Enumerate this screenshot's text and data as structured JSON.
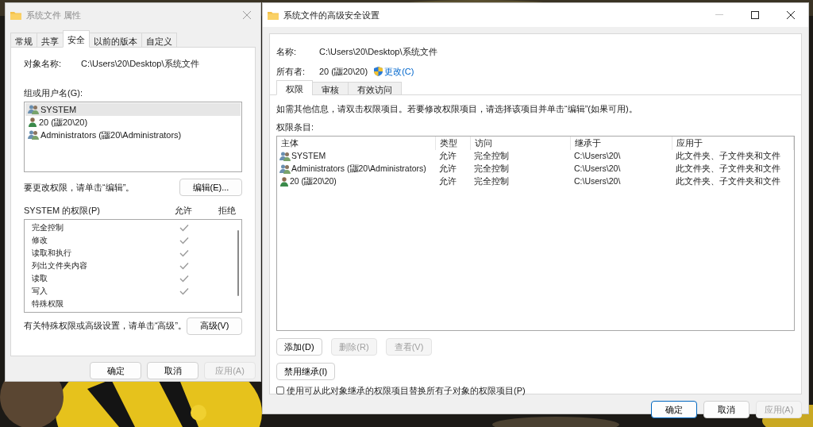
{
  "left_window": {
    "title": "系统文件 属性",
    "tabs": [
      {
        "label": "常规",
        "selected": false
      },
      {
        "label": "共享",
        "selected": false
      },
      {
        "label": "安全",
        "selected": true
      },
      {
        "label": "以前的版本",
        "selected": false
      },
      {
        "label": "自定义",
        "selected": false
      }
    ],
    "object_name_label": "对象名称:",
    "object_name": "C:\\Users\\20\\Desktop\\系统文件",
    "groups_label": "组或用户名(G):",
    "groups": [
      {
        "name": "SYSTEM",
        "kind": "group",
        "selected": true
      },
      {
        "name": "20 (鼴20\\20)",
        "kind": "user",
        "selected": false
      },
      {
        "name": "Administrators (鼴20\\Administrators)",
        "kind": "group",
        "selected": false
      }
    ],
    "edit_hint": "要更改权限，请单击“编辑”。",
    "edit_button": "编辑(E)...",
    "permissions_label": "SYSTEM 的权限(P)",
    "allow_header": "允许",
    "deny_header": "拒绝",
    "permissions": [
      {
        "name": "完全控制",
        "allow": true
      },
      {
        "name": "修改",
        "allow": true
      },
      {
        "name": "读取和执行",
        "allow": true
      },
      {
        "name": "列出文件夹内容",
        "allow": true
      },
      {
        "name": "读取",
        "allow": true
      },
      {
        "name": "写入",
        "allow": true
      },
      {
        "name": "特殊权限",
        "allow": false
      }
    ],
    "advanced_hint": "有关特殊权限或高级设置，请单击“高级”。",
    "advanced_button": "高级(V)",
    "buttons": [
      {
        "label": "确定",
        "disabled": false
      },
      {
        "label": "取消",
        "disabled": false
      },
      {
        "label": "应用(A)",
        "disabled": true
      }
    ]
  },
  "right_window": {
    "title": "系统文件的高级安全设置",
    "name_label": "名称:",
    "name": "C:\\Users\\20\\Desktop\\系统文件",
    "owner_label": "所有者:",
    "owner": "20 (鼴20\\20)",
    "change_link": "更改(C)",
    "tabs": [
      {
        "label": "权限",
        "selected": true
      },
      {
        "label": "审核",
        "selected": false
      },
      {
        "label": "有效访问",
        "selected": false
      }
    ],
    "info": "如需其他信息，请双击权限项目。若要修改权限项目，请选择该项目并单击“编辑”(如果可用)。",
    "entries_label": "权限条目:",
    "columns": [
      "主体",
      "类型",
      "访问",
      "继承于",
      "应用于"
    ],
    "rows": [
      {
        "principal": "SYSTEM",
        "kind": "group",
        "type": "允许",
        "access": "完全控制",
        "inherited_from": "C:\\Users\\20\\",
        "applies_to": "此文件夹、子文件夹和文件"
      },
      {
        "principal": "Administrators (鼴20\\Administrators)",
        "kind": "group",
        "type": "允许",
        "access": "完全控制",
        "inherited_from": "C:\\Users\\20\\",
        "applies_to": "此文件夹、子文件夹和文件"
      },
      {
        "principal": "20 (鼴20\\20)",
        "kind": "user",
        "type": "允许",
        "access": "完全控制",
        "inherited_from": "C:\\Users\\20\\",
        "applies_to": "此文件夹、子文件夹和文件"
      }
    ],
    "action_buttons": [
      {
        "label": "添加(D)",
        "disabled": false
      },
      {
        "label": "删除(R)",
        "disabled": true
      },
      {
        "label": "查看(V)",
        "disabled": true
      }
    ],
    "disable_inheritance_button": "禁用继承(I)",
    "replace_checkbox": {
      "label": "使用可从此对象继承的权限项目替换所有子对象的权限项目(P)",
      "checked": false
    },
    "buttons": [
      {
        "label": "确定",
        "disabled": false,
        "default": true
      },
      {
        "label": "取消",
        "disabled": false,
        "default": false
      },
      {
        "label": "应用(A)",
        "disabled": true,
        "default": false
      }
    ]
  }
}
